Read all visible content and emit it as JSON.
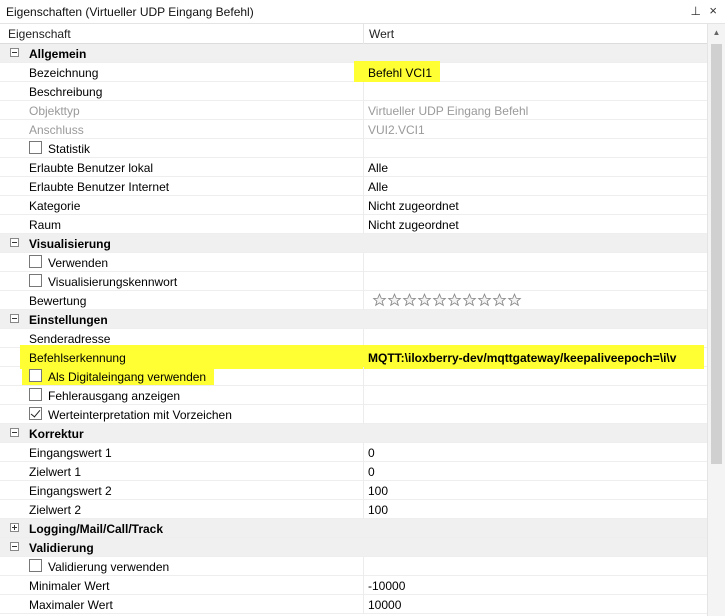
{
  "window": {
    "title": "Eigenschaften (Virtueller UDP Eingang Befehl)",
    "pin": "⊥",
    "close": "×"
  },
  "header": {
    "col1": "Eigenschaft",
    "col2": "Wert"
  },
  "groups": {
    "allgemein": {
      "label": "Allgemein",
      "bezeichnung": {
        "label": "Bezeichnung",
        "value": "Befehl VCI1"
      },
      "beschreibung": {
        "label": "Beschreibung",
        "value": ""
      },
      "objekttyp": {
        "label": "Objekttyp",
        "value": "Virtueller UDP Eingang Befehl"
      },
      "anschluss": {
        "label": "Anschluss",
        "value": "VUI2.VCI1"
      },
      "statistik": {
        "label": "Statistik",
        "checked": false
      },
      "benutzer_lokal": {
        "label": "Erlaubte Benutzer lokal",
        "value": "Alle"
      },
      "benutzer_internet": {
        "label": "Erlaubte Benutzer Internet",
        "value": "Alle"
      },
      "kategorie": {
        "label": "Kategorie",
        "value": "Nicht zugeordnet"
      },
      "raum": {
        "label": "Raum",
        "value": "Nicht zugeordnet"
      }
    },
    "visualisierung": {
      "label": "Visualisierung",
      "verwenden": {
        "label": "Verwenden",
        "checked": false
      },
      "kennwort": {
        "label": "Visualisierungskennwort",
        "checked": false
      },
      "bewertung": {
        "label": "Bewertung",
        "stars": 10,
        "rating": 0
      }
    },
    "einstellungen": {
      "label": "Einstellungen",
      "senderadresse": {
        "label": "Senderadresse",
        "value": ""
      },
      "befehlserkennung": {
        "label": "Befehlserkennung",
        "value": "MQTT:\\iloxberry-dev/mqttgateway/keepaliveepoch=\\i\\v"
      },
      "digitaleingang": {
        "label": "Als Digitaleingang verwenden",
        "checked": false
      },
      "fehlerausgang": {
        "label": "Fehlerausgang anzeigen",
        "checked": false
      },
      "vorzeichen": {
        "label": "Werteinterpretation mit Vorzeichen",
        "checked": true
      }
    },
    "korrektur": {
      "label": "Korrektur",
      "eingangswert1": {
        "label": "Eingangswert 1",
        "value": "0"
      },
      "zielwert1": {
        "label": "Zielwert 1",
        "value": "0"
      },
      "eingangswert2": {
        "label": "Eingangswert 2",
        "value": "100"
      },
      "zielwert2": {
        "label": "Zielwert 2",
        "value": "100"
      }
    },
    "logging": {
      "label": "Logging/Mail/Call/Track"
    },
    "validierung": {
      "label": "Validierung",
      "verwenden": {
        "label": "Validierung verwenden",
        "checked": false
      },
      "min": {
        "label": "Minimaler Wert",
        "value": "-10000"
      },
      "max": {
        "label": "Maximaler Wert",
        "value": "10000"
      }
    }
  },
  "colors": {
    "highlight": "#ffff33",
    "category_bg": "#f0f0f0",
    "readonly_text": "#9a9a9a"
  }
}
